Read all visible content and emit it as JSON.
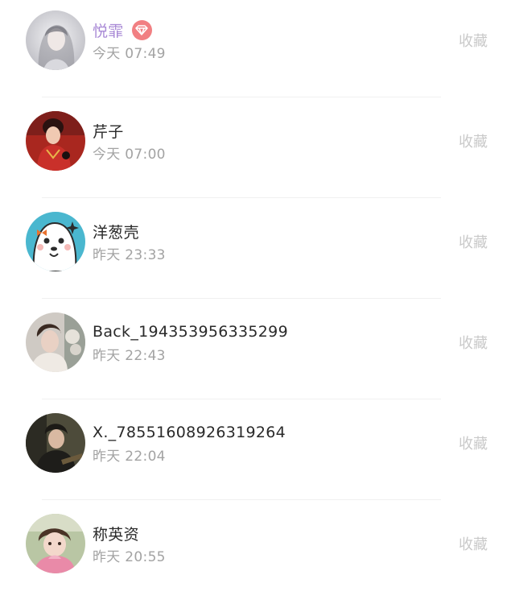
{
  "colors": {
    "name_default": "#2a2a2a",
    "name_vip": "#a98ad6",
    "time": "#a3a3a3",
    "favorite_action": "#c9c9c9",
    "vip_badge": "#f17f82",
    "divider": "#f0f0f0"
  },
  "items": [
    {
      "name": "悦霏",
      "vip": true,
      "badge_icon": "diamond-icon",
      "time": "今天 07:49",
      "action": "收藏"
    },
    {
      "name": "芹子",
      "vip": false,
      "time": "今天 07:00",
      "action": "收藏"
    },
    {
      "name": "洋葱壳",
      "vip": false,
      "time": "昨天 23:33",
      "action": "收藏"
    },
    {
      "name": "Back_194353956335299",
      "vip": false,
      "time": "昨天 22:43",
      "action": "收藏"
    },
    {
      "name": "X._78551608926319264",
      "vip": false,
      "time": "昨天 22:04",
      "action": "收藏"
    },
    {
      "name": "称英资",
      "vip": false,
      "time": "昨天 20:55",
      "action": "收藏"
    }
  ]
}
